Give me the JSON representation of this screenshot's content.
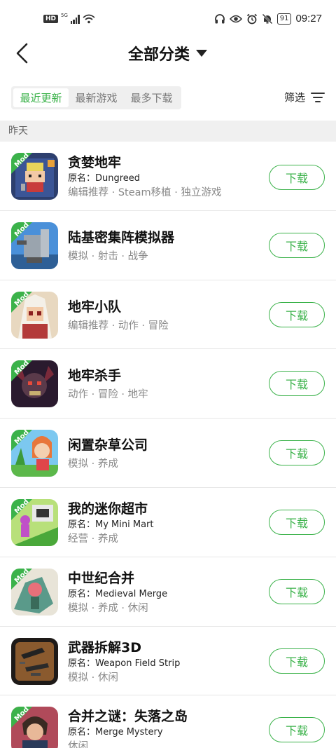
{
  "status_bar": {
    "hd": "HD",
    "network": "5G",
    "battery": "91",
    "time": "09:27",
    "icons": [
      "headphones-icon",
      "eye-icon",
      "alarm-icon",
      "mute-icon"
    ]
  },
  "nav": {
    "title": "全部分类",
    "back_icon": "chevron-left-icon",
    "dropdown_icon": "caret-down-icon"
  },
  "sort_tabs": [
    "最近更新",
    "最新游戏",
    "最多下载"
  ],
  "active_tab": 0,
  "filter": {
    "label": "筛选",
    "icon": "filter-lines-icon"
  },
  "section": {
    "label": "昨天"
  },
  "badge_label": "Mod",
  "download_label": "下载",
  "accent_color": "#3bb24a",
  "games": [
    {
      "title": "贪婪地牢",
      "original": "原名：Dungreed",
      "tags": "编辑推荐 · Steam移植 · 独立游戏"
    },
    {
      "title": "陆基密集阵模拟器",
      "original": "",
      "tags": "模拟 · 射击 · 战争"
    },
    {
      "title": "地牢小队",
      "original": "",
      "tags": "编辑推荐 · 动作 · 冒险"
    },
    {
      "title": "地牢杀手",
      "original": "",
      "tags": "动作 · 冒险 · 地牢"
    },
    {
      "title": "闲置杂草公司",
      "original": "",
      "tags": "模拟 · 养成"
    },
    {
      "title": "我的迷你超市",
      "original": "原名：My Mini Mart",
      "tags": "经营 · 养成"
    },
    {
      "title": "中世纪合并",
      "original": "原名：Medieval Merge",
      "tags": "模拟 · 养成 · 休闲"
    },
    {
      "title": "武器拆解3D",
      "original": "原名：Weapon Field Strip",
      "tags": "模拟 · 休闲"
    },
    {
      "title": "合并之谜：失落之岛",
      "original": "原名：Merge Mystery",
      "tags": "休闲"
    }
  ]
}
